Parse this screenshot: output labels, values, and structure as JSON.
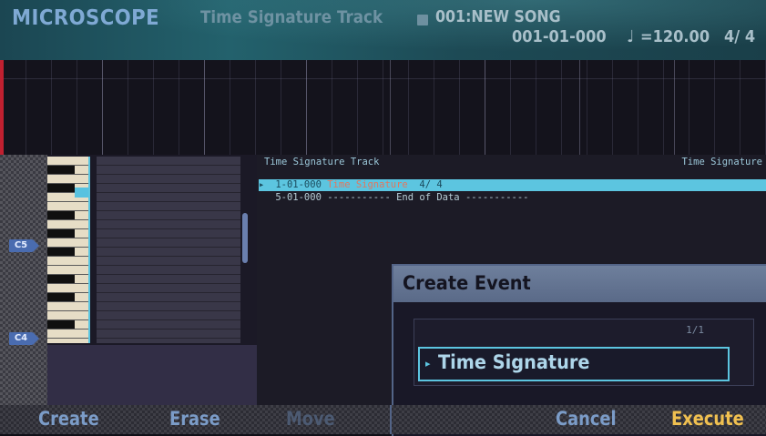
{
  "header": {
    "app_title": "MICROSCOPE",
    "track_title": "Time Signature Track",
    "song_icon": "song-square-icon",
    "song_name": "001:NEW SONG",
    "position": "001-01-000",
    "tempo_icon": "♩",
    "tempo": "=120.00",
    "time_signature": "4/ 4"
  },
  "keyboard": {
    "note_labels": [
      "C5",
      "C4"
    ]
  },
  "event_list": {
    "header_left": "Time Signature Track",
    "header_right": "Time Signature",
    "rows": [
      {
        "cursor": "▸",
        "position": "1-01-000",
        "event": "Time Signature",
        "value": "4/ 4",
        "selected": true
      },
      {
        "cursor": "",
        "position": "5-01-000",
        "event": "----------- End of Data -----------",
        "value": "",
        "selected": false
      }
    ]
  },
  "dialog": {
    "title": "Create Event",
    "page_indicator": "1/1",
    "option_arrow": "▸",
    "option_label": "Time Signature"
  },
  "function_bar": {
    "create": "Create",
    "erase": "Erase",
    "move": "Move",
    "cancel": "Cancel",
    "execute": "Execute"
  },
  "colors": {
    "accent": "#5cc5e0",
    "execute": "#f0c050",
    "playhead": "#c02030"
  }
}
